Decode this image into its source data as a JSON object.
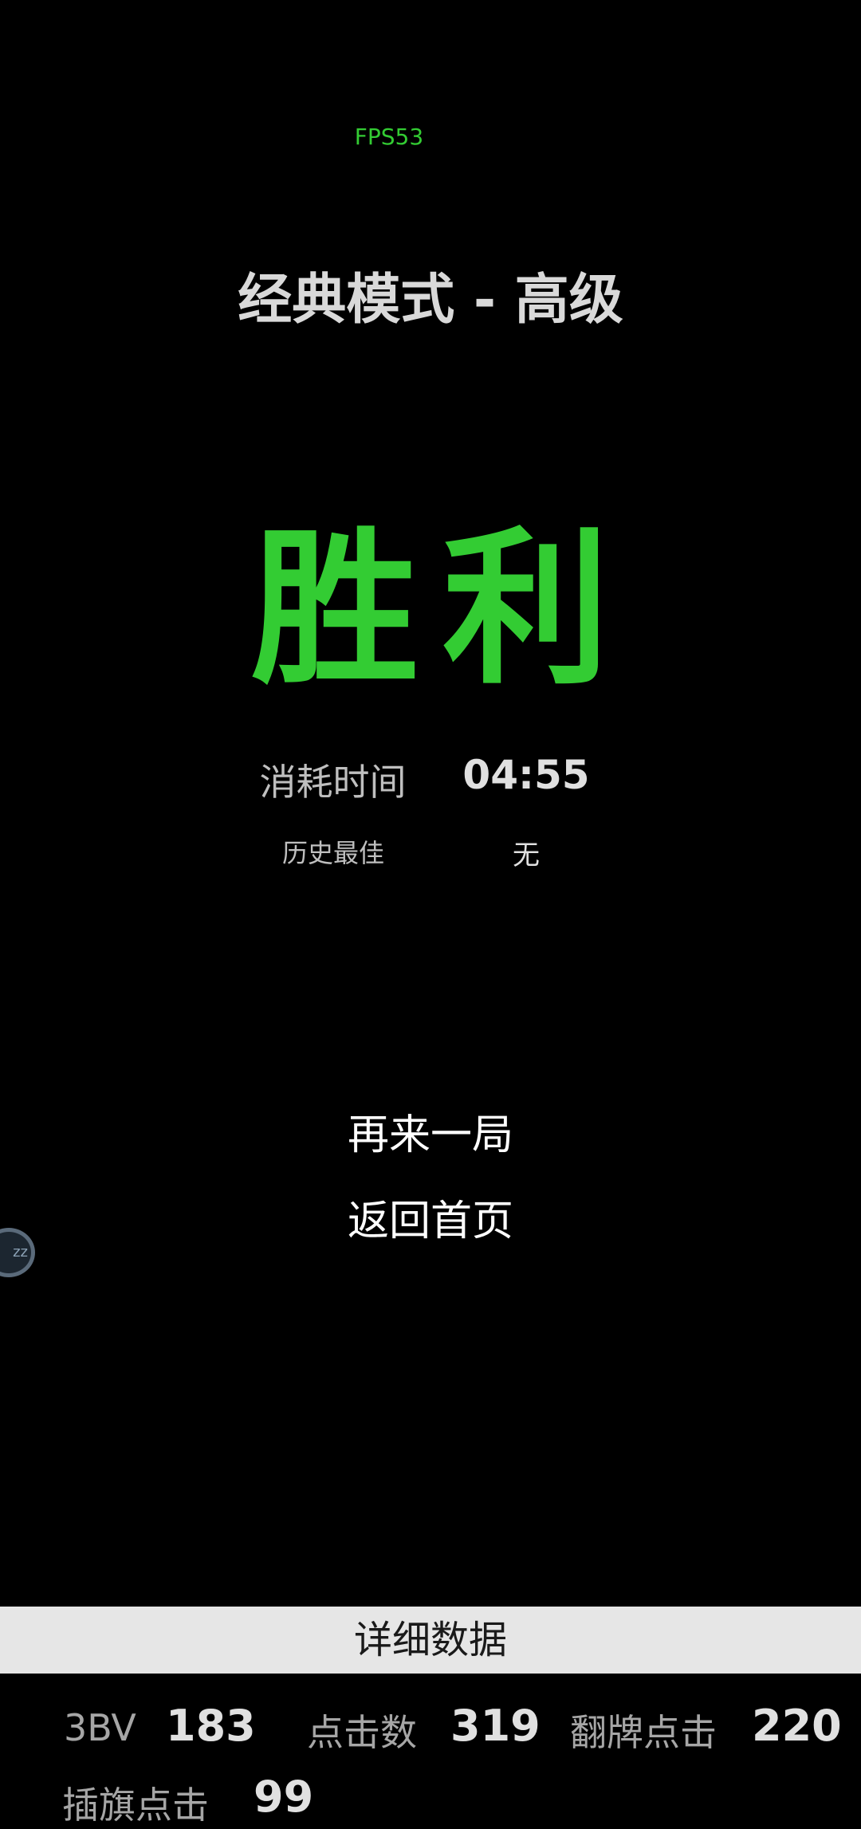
{
  "hud": {
    "fps": "FPS53"
  },
  "game": {
    "mode_title": "经典模式 - 高级",
    "result": "胜利"
  },
  "time": {
    "label": "消耗时间",
    "value": "04:55"
  },
  "best": {
    "label": "历史最佳",
    "value": "无"
  },
  "actions": {
    "play_again": "再来一局",
    "back_home": "返回首页"
  },
  "floating_ball": {
    "text": "zz"
  },
  "details": {
    "header": "详细数据",
    "stats": [
      {
        "label": "3BV",
        "value": "183"
      },
      {
        "label": "点击数",
        "value": "319"
      },
      {
        "label": "翻牌点击",
        "value": "220"
      },
      {
        "label": "插旗点击",
        "value": "99"
      }
    ]
  },
  "colors": {
    "accent_green": "#33cc33",
    "background": "#000000",
    "detail_bar": "#e6e6e6"
  }
}
